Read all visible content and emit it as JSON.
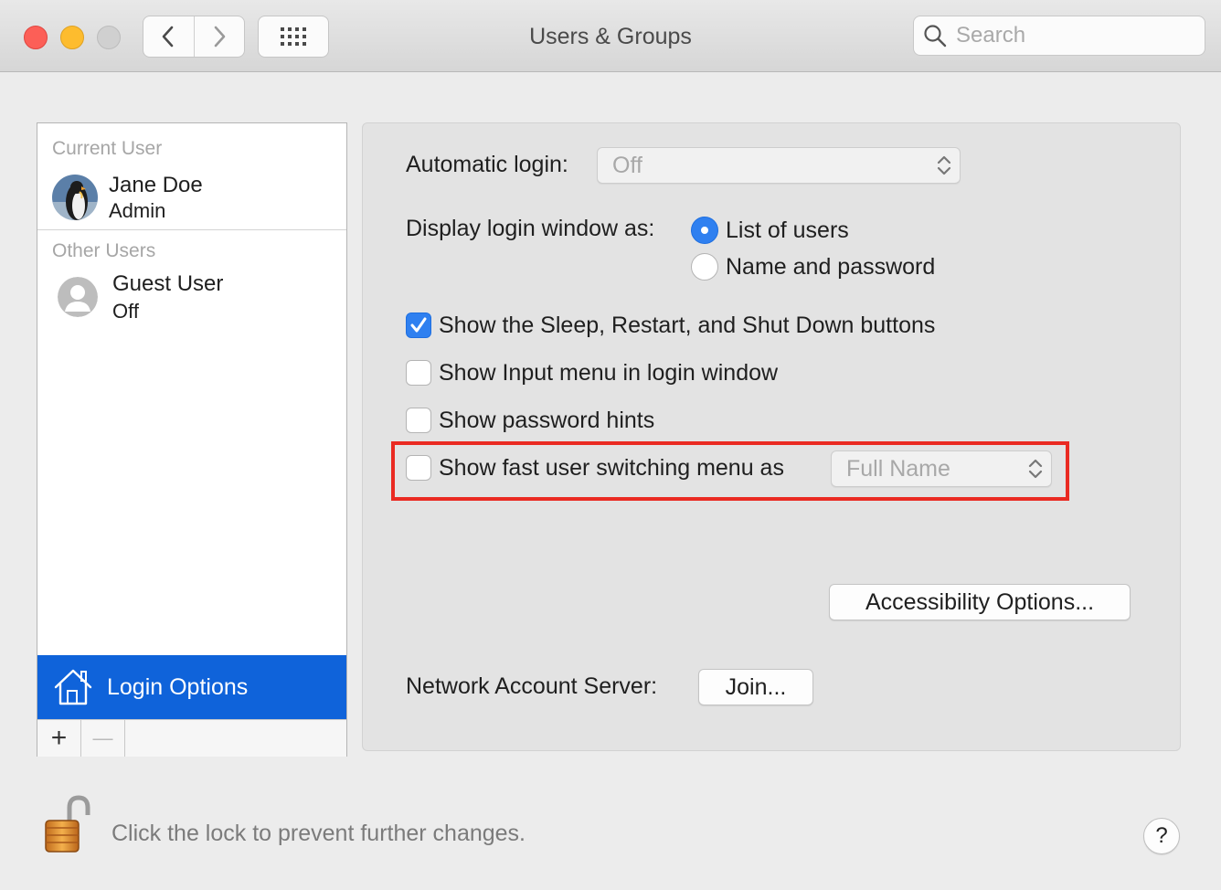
{
  "window": {
    "title": "Users & Groups",
    "search_placeholder": "Search"
  },
  "sidebar": {
    "current_user_header": "Current User",
    "current_user": {
      "name": "Jane Doe",
      "role": "Admin"
    },
    "other_users_header": "Other Users",
    "other_users": [
      {
        "name": "Guest User",
        "status": "Off"
      }
    ],
    "login_options_label": "Login Options",
    "add_symbol": "+",
    "remove_symbol": "—"
  },
  "login_panel": {
    "automatic_login_label": "Automatic login:",
    "automatic_login_value": "Off",
    "display_login_label": "Display login window as:",
    "display_options": [
      {
        "label": "List of users",
        "selected": true
      },
      {
        "label": "Name and password",
        "selected": false
      }
    ],
    "checkboxes": [
      {
        "label": "Show the Sleep, Restart, and Shut Down buttons",
        "checked": true
      },
      {
        "label": "Show Input menu in login window",
        "checked": false
      },
      {
        "label": "Show password hints",
        "checked": false
      },
      {
        "label": "Show fast user switching menu as",
        "checked": false
      }
    ],
    "fast_switch_value": "Full Name",
    "accessibility_button": "Accessibility Options...",
    "network_server_label": "Network Account Server:",
    "join_button": "Join..."
  },
  "footer": {
    "lock_text": "Click the lock to prevent further changes.",
    "help_symbol": "?"
  },
  "colors": {
    "accent": "#0f63da",
    "highlight_box": "#ea2a22",
    "close": "#fc5f57",
    "minimize": "#fdbc2e"
  }
}
